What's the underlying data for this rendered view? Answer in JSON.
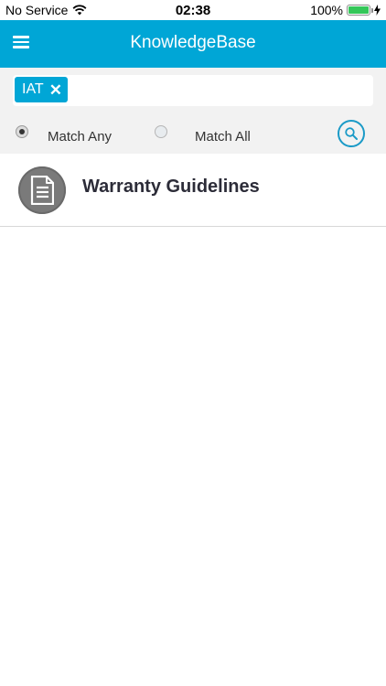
{
  "status_bar": {
    "carrier": "No Service",
    "time": "02:38",
    "battery": "100%",
    "icons": [
      "wifi-icon",
      "battery-icon",
      "charging-icon"
    ]
  },
  "header": {
    "title": "KnowledgeBase",
    "menu_icon": "hamburger-menu-icon",
    "background": "#00a6d6"
  },
  "filter": {
    "tags": [
      {
        "label": "IAT",
        "remove_icon": "close-icon"
      }
    ],
    "match_options": [
      {
        "label": "Match Any",
        "selected": true
      },
      {
        "label": "Match All",
        "selected": false
      }
    ],
    "search_icon": "search-icon"
  },
  "results": [
    {
      "title": "Warranty Guidelines",
      "icon": "document-icon"
    }
  ]
}
